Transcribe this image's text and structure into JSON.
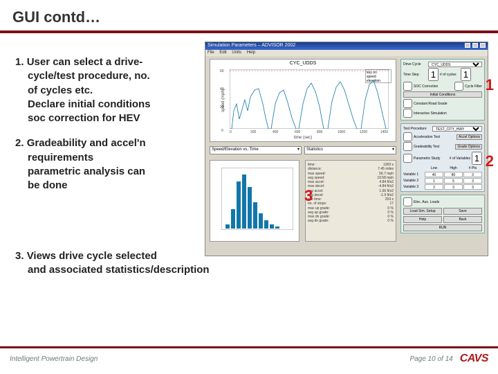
{
  "title": "GUI contd…",
  "bullets": {
    "b1_prefix": "1. ",
    "b1_line1": "User can select a drive-",
    "b1_line2": "cycle/test procedure, no.",
    "b1_line3": "of cycles etc.",
    "b1_line4": "Declare initial conditions",
    "b1_line5": " soc correction for HEV",
    "b2_prefix": "2. ",
    "b2_line1": "Gradeability and accel'n",
    "b2_line2": "requirements",
    "b2_line3": "parametric analysis can",
    "b2_line4": "be done",
    "b3_prefix": "3. ",
    "b3_line1": "Views drive cycle selected",
    "b3_line2": "and associated statistics/description"
  },
  "app": {
    "title": "Simulation Parameters – ADVISOR 2002",
    "menu": {
      "m1": "File",
      "m2": "Edit",
      "m3": "Units",
      "m4": "Help"
    },
    "plot_title": "CYC_UDDS",
    "ylabel": "speed (mph)",
    "xlabel": "time (sec)",
    "xticks": {
      "t0": "0",
      "t1": "200",
      "t2": "400",
      "t3": "600",
      "t4": "800",
      "t5": "1000",
      "t6": "1200",
      "t7": "1400"
    },
    "yticks": {
      "y0": "0",
      "y1": "20",
      "y2": "40",
      "y3": "60"
    },
    "legend": {
      "l1": "key on",
      "l2": "speed",
      "l3": "elevation"
    },
    "dd1": "Speed/Elevation vs. Time",
    "dd2": "Statistics",
    "stats": {
      "r1": {
        "k": "time:",
        "v": "1369 s"
      },
      "r2": {
        "k": "distance:",
        "v": "7.45 miles"
      },
      "r3": {
        "k": "max speed:",
        "v": "56.7 mph"
      },
      "r4": {
        "k": "avg speed:",
        "v": "19.58 mph"
      },
      "r5": {
        "k": "max accel:",
        "v": "4.84 ft/s2"
      },
      "r6": {
        "k": "max decel:",
        "v": "-4.84 ft/s2"
      },
      "r7": {
        "k": "avg accel:",
        "v": "1.66 ft/s2"
      },
      "r8": {
        "k": "avg decel:",
        "v": "-1.9 ft/s2"
      },
      "r9": {
        "k": "idle time:",
        "v": "259 s"
      },
      "r10": {
        "k": "no. of stops:",
        "v": "17"
      },
      "r11": {
        "k": "max up grade:",
        "v": "0 %"
      },
      "r12": {
        "k": "avg up grade:",
        "v": "0 %"
      },
      "r13": {
        "k": "max dn grade:",
        "v": "0 %"
      },
      "r14": {
        "k": "avg dn grade:",
        "v": "0 %"
      }
    },
    "p1": {
      "drive_cycle_lbl": "Drive Cycle",
      "drive_cycle_val": "CYC_UDDS",
      "trip_lbl": "Time Step",
      "trip_val": "1",
      "cycles_lbl": "# of cycles",
      "cycles_val": "1",
      "soc_chk": "SOC Correction",
      "cycle_filter_chk": "Cycle Filter",
      "init_btn": "Initial Conditions",
      "rtext1": "Constant Road Grade",
      "rtext2": "Interactive Simulation"
    },
    "p2": {
      "test_lbl": "Test Procedure",
      "test_val": "TEST_CITY_HWY",
      "accel_chk": "Acceleration Test",
      "accel_opt": "Accel Options",
      "grade_chk": "Gradeability Test",
      "grade_opt": "Grade Options",
      "param_lbl": "Parametric Study",
      "var_lbl": "# of Variables",
      "var_val": "1",
      "low_lbl": "Low",
      "high_lbl": "High",
      "pts_lbl": "# Pts",
      "var1_lbl": "Variable 1",
      "var1_p1": "40",
      "var1_p2": "80",
      "var1_p3": "3",
      "var2_lbl": "Variable 2",
      "var2_p1": "1",
      "var2_p2": "5",
      "var2_p3": "3",
      "var3_lbl": "Variable 3",
      "var3_p1": "2",
      "var3_p2": "3",
      "var3_p3": "3"
    },
    "p3": {
      "aux_chk": "Elec. Aux. Loads",
      "load_btn": "Load Sim. Setup",
      "save_btn": "Save",
      "help_btn": "Help",
      "back_btn": "Back",
      "run_btn": "RUN"
    }
  },
  "callouts": {
    "c1": "1",
    "c2": "2",
    "c3": "3"
  },
  "footer": {
    "left": "Intelligent Powertrain Design",
    "page": "Page 10 of 14",
    "logo": "CAVS"
  }
}
